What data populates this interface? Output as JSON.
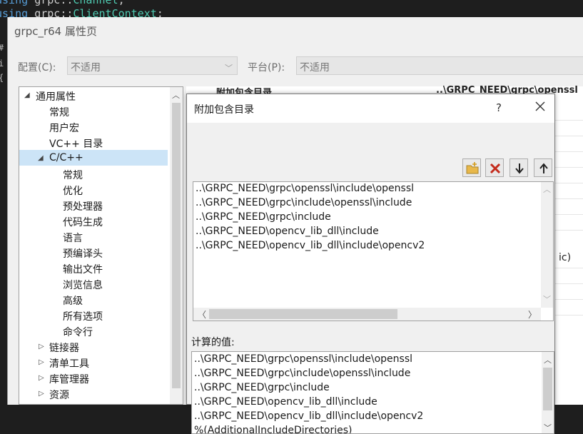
{
  "code": {
    "line1": {
      "kw": "using",
      "ns": "grpc",
      "sep": "::",
      "ty": "Channel",
      "end": ";"
    },
    "line2": {
      "kw": "using",
      "ns": "grpc",
      "sep": "::",
      "ty": "ClientContext",
      "end": ";"
    },
    "side": [
      "#",
      "i",
      "{"
    ]
  },
  "window": {
    "title": "grpc_r64 属性页",
    "config_label": "配置(C):",
    "config_value": "不适用",
    "platform_label": "平台(P):",
    "platform_value": "不适用"
  },
  "tree": {
    "root": "通用属性",
    "items": [
      {
        "label": "常规"
      },
      {
        "label": "用户宏"
      },
      {
        "label": "VC++ 目录"
      }
    ],
    "cpp": {
      "label": "C/C++",
      "children": [
        "常规",
        "优化",
        "预处理器",
        "代码生成",
        "语言",
        "预编译头",
        "输出文件",
        "浏览信息",
        "高级",
        "所有选项",
        "命令行"
      ]
    },
    "collapsed": [
      "链接器",
      "清单工具",
      "库管理器",
      "资源"
    ]
  },
  "grid": {
    "header_name": "附加包含目录",
    "header_value": "..\\GRPC_NEED\\grpc\\openssl",
    "peek_text": "ic)"
  },
  "dialog": {
    "title": "附加包含目录",
    "help": "?",
    "toolbar": {
      "new_line": "new-folder-icon",
      "delete": "delete-icon",
      "move_down": "arrow-down-icon",
      "move_up": "arrow-up-icon"
    },
    "paths": [
      "..\\GRPC_NEED\\grpc\\openssl\\include\\openssl",
      "..\\GRPC_NEED\\grpc\\include\\openssl\\include",
      "..\\GRPC_NEED\\grpc\\include",
      "..\\GRPC_NEED\\opencv_lib_dll\\include",
      "..\\GRPC_NEED\\opencv_lib_dll\\include\\opencv2"
    ],
    "calc_label": "计算的值:",
    "calc_values": [
      "..\\GRPC_NEED\\grpc\\openssl\\include\\openssl",
      "..\\GRPC_NEED\\grpc\\include\\openssl\\include",
      "..\\GRPC_NEED\\grpc\\include",
      "..\\GRPC_NEED\\opencv_lib_dll\\include",
      "..\\GRPC_NEED\\opencv_lib_dll\\include\\opencv2",
      "%(AdditionalIncludeDirectories)"
    ]
  },
  "colors": {
    "selection": "#cce4f7",
    "delete_red": "#c42b1c",
    "folder_yellow": "#e8b84a"
  }
}
